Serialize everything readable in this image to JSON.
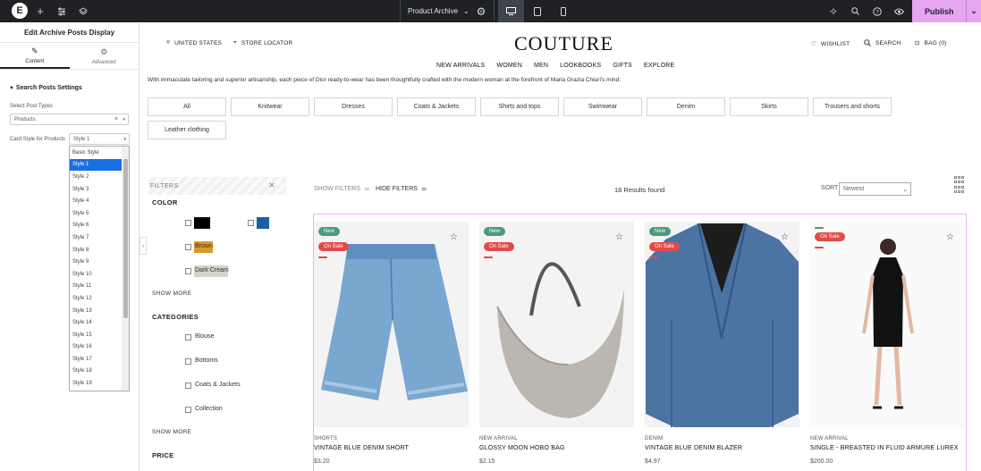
{
  "toolbar": {
    "page_name": "Product Archive",
    "publish_label": "Publish"
  },
  "panel": {
    "title": "Edit Archive Posts Display",
    "tabs": [
      {
        "label": "Content"
      },
      {
        "label": "Advanced"
      }
    ],
    "section_title": "Search Posts Settings",
    "post_types_label": "Select Post Types",
    "post_types_value": "Products",
    "card_style_label": "Card Style for Products",
    "card_style_value": "Style 1",
    "card_style_options": [
      "Basic Style",
      "Style 1",
      "Style 2",
      "Style 3",
      "Style 4",
      "Style 5",
      "Style 6",
      "Style 7",
      "Style 8",
      "Style 9",
      "Style 10",
      "Style 11",
      "Style 12",
      "Style 13",
      "Style 14",
      "Style 15",
      "Style 16",
      "Style 17",
      "Style 18",
      "Style 19"
    ],
    "selected_option": "Style 1"
  },
  "site": {
    "country": "UNITED STATES",
    "store_locator": "STORE LOCATOR",
    "brand": "COUTURE",
    "wishlist": "WISHLIST",
    "search": "SEARCH",
    "bag": "BAG (0)",
    "nav": [
      "NEW ARRIVALS",
      "WOMEN",
      "MEN",
      "LOOKBOOKS",
      "GIFTS",
      "EXPLORE"
    ],
    "intro": "With immaculate tailoring and superior artisanship, each piece of Dior ready-to-wear has been thoughtfully crafted with the modern woman at the forefront of Maria Grazia Chiuri's mind.",
    "categories": [
      "All",
      "Knitwear",
      "Dresses",
      "Coats & Jackets",
      "Shirts and tops",
      "Swimwear",
      "Denim",
      "Skirts",
      "Trousers and shorts",
      "Leather clothing"
    ],
    "filters": {
      "header": "FILTERS",
      "color_title": "COLOR",
      "colors": [
        {
          "name": "",
          "hex": "#000000"
        },
        {
          "name": "Blue",
          "hex": "#1a5fa8"
        },
        {
          "name": "Brown",
          "hex": "#d99a2b"
        },
        {
          "name": "Dark Cream",
          "hex": "#d3d3cb"
        }
      ],
      "show_more": "SHOW MORE",
      "categories_title": "CATEGORIES",
      "category_items": [
        "Blouse",
        "Bottoms",
        "Coats & Jackets",
        "Collection"
      ],
      "price_title": "PRICE"
    },
    "show_filters": "SHOW FILTERS",
    "hide_filters": "HIDE FILTERS",
    "results": "18 Results found",
    "sort_label": "SORT",
    "sort_value": "Newest",
    "products": [
      {
        "category": "SHORTS",
        "name": "VINTAGE BLUE DENIM SHORT",
        "price": "$3.20",
        "badges": [
          "New",
          "On Sale"
        ]
      },
      {
        "category": "NEW ARRIVAL",
        "name": "GLOSSY MOON HOBO BAG",
        "price": "$2.15",
        "badges": [
          "New",
          "On Sale"
        ]
      },
      {
        "category": "DENIM",
        "name": "VINTAGE BLUE DENIM BLAZER",
        "price": "$4.97",
        "badges": [
          "New",
          "On Sale"
        ]
      },
      {
        "category": "NEW ARRIVAL",
        "name": "SINGLE - BREASTED IN FLUID ARMURE LUREX",
        "price": "$200.00",
        "badges": [
          "On Sale"
        ]
      }
    ]
  }
}
